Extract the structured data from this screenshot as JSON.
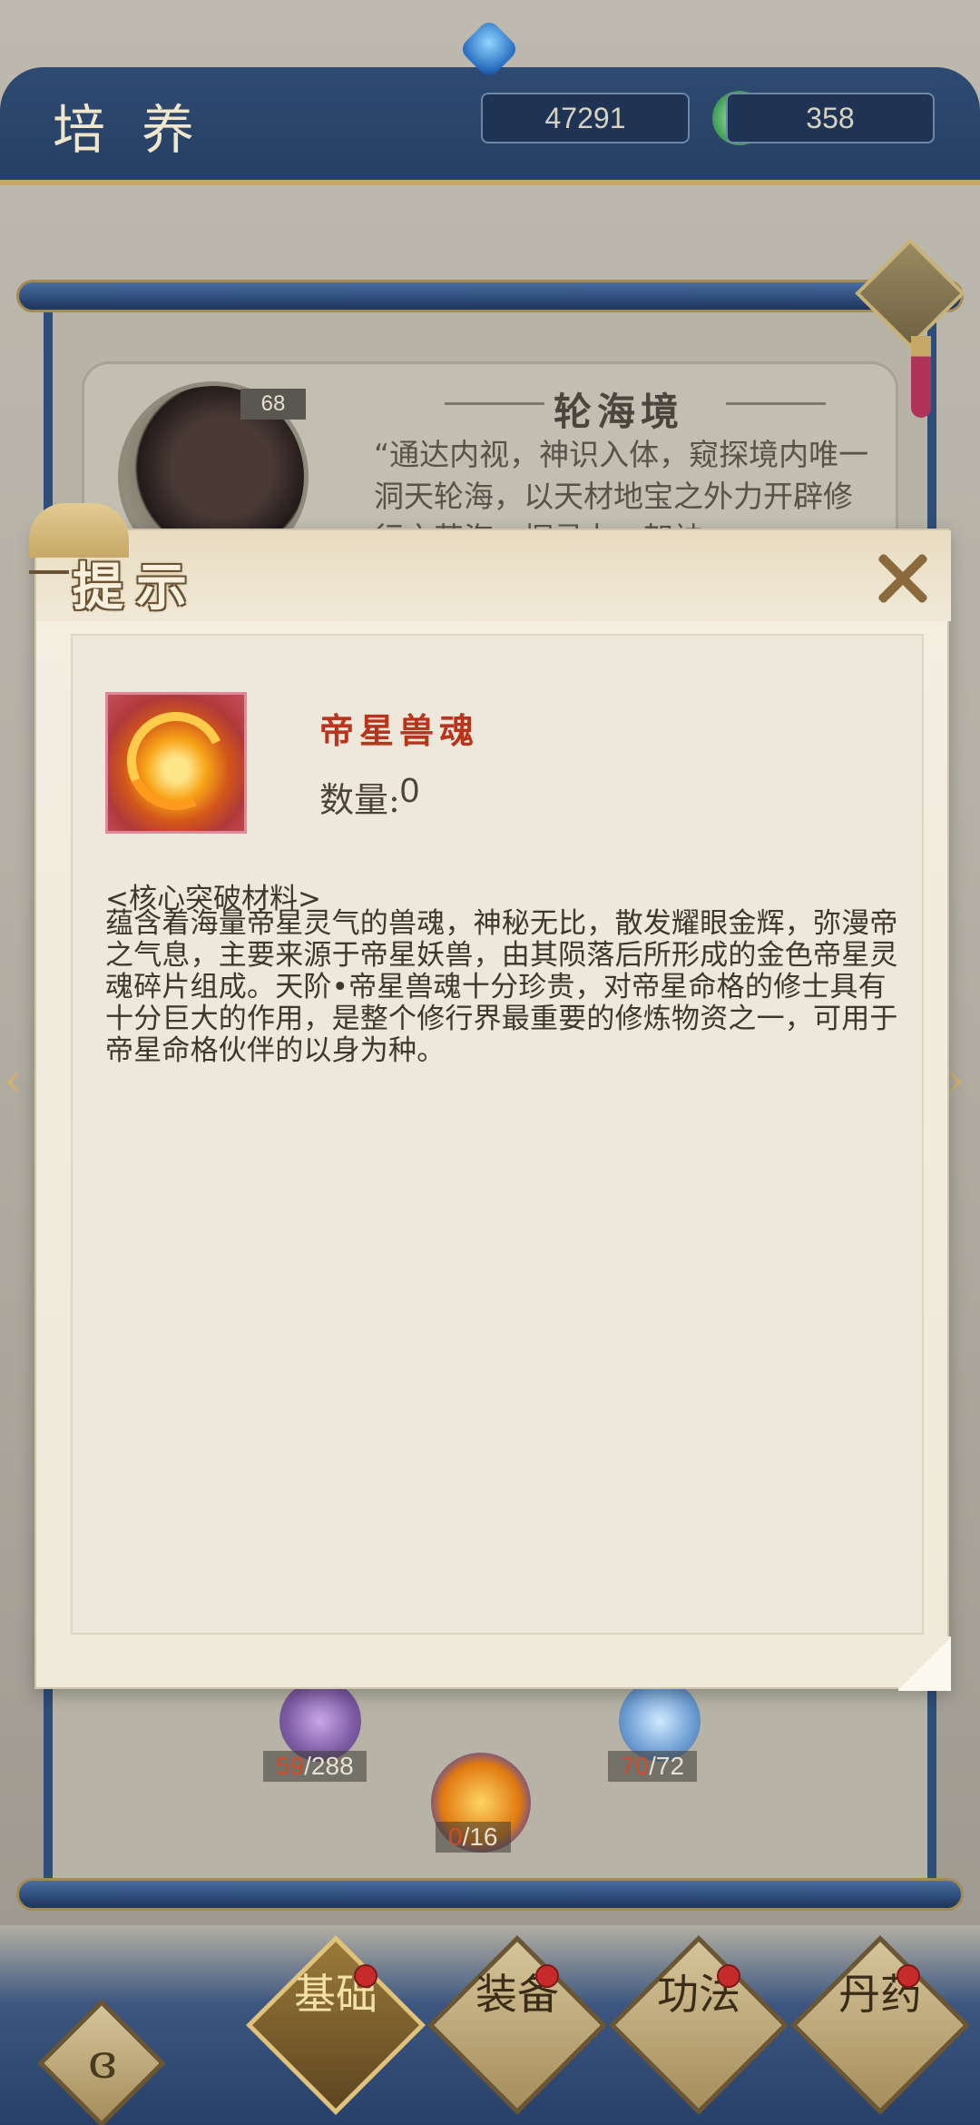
{
  "topbar": {
    "title": "培养",
    "gem_value": "47291",
    "jade_value": "358"
  },
  "realm": {
    "level": "68",
    "title": "轮海境",
    "description": "“通达内视，神识入体，窥探境内唯一洞天轮海，以天材地宝之外力开辟修行之苦海，探寻力，架神"
  },
  "slots": {
    "left": {
      "have": "59",
      "need": "/288"
    },
    "right": {
      "have": "70",
      "need": "/72"
    },
    "center": {
      "have": "0",
      "need": "/16"
    }
  },
  "nav": {
    "tab_basic": "基础",
    "tab_equip": "装备",
    "tab_skill": "功法",
    "tab_pill": "丹药"
  },
  "modal": {
    "title": "提示",
    "item_name": "帝星兽魂",
    "qty_label": "数量:",
    "qty_value": "0",
    "category": "<核心突破材料>",
    "description": "蕴含着海量帝星灵气的兽魂，神秘无比，散发耀眼金辉，弥漫帝之气息，主要来源于帝星妖兽，由其陨落后所形成的金色帝星灵魂碎片组成。天阶•帝星兽魂十分珍贵，对帝星命格的修士具有十分巨大的作用，是整个修行界最重要的修炼物资之一，可用于帝星命格伙伴的以身为种。"
  },
  "colors": {
    "item_name": "#b8341c",
    "modal_bg": "#efe9da",
    "topbar": "#2f4a72"
  },
  "icons": {
    "gem": "blue-crystal-icon",
    "jade": "jade-coin-icon",
    "close": "close-icon",
    "home": "home-emblem-icon"
  }
}
